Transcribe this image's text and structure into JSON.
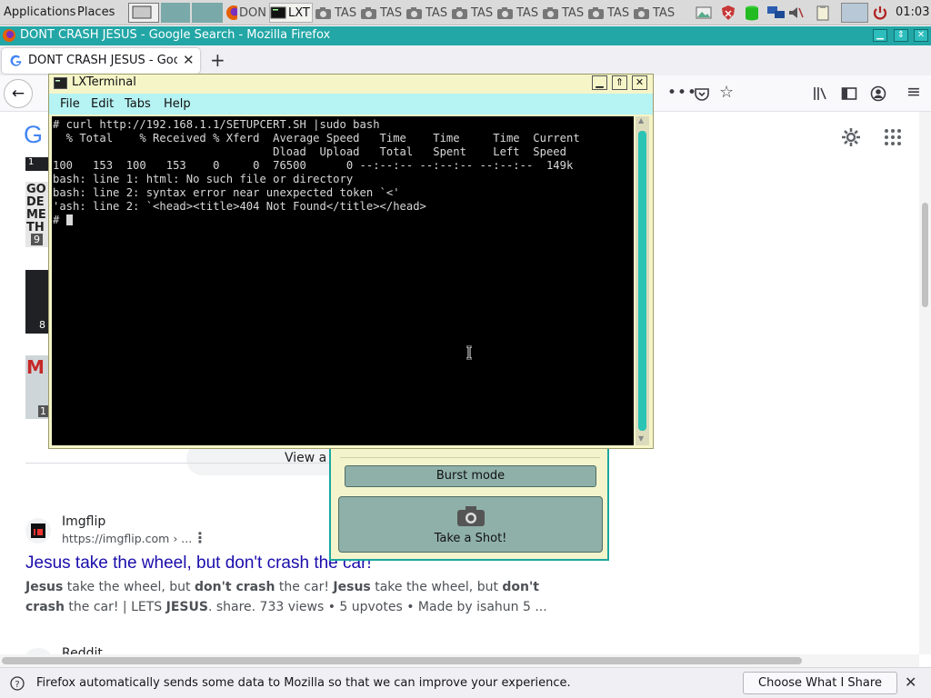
{
  "panel": {
    "applications": "Applications",
    "places": "Places",
    "tasks": [
      {
        "label": "DON",
        "icon": "firefox-icon"
      },
      {
        "label": "LXT",
        "icon": "terminal-icon"
      },
      {
        "label": "TAS",
        "icon": "camera-icon"
      },
      {
        "label": "TAS",
        "icon": "camera-icon"
      },
      {
        "label": "TAS",
        "icon": "camera-icon"
      },
      {
        "label": "TAS",
        "icon": "camera-icon"
      },
      {
        "label": "TAS",
        "icon": "camera-icon"
      },
      {
        "label": "TAS",
        "icon": "camera-icon"
      },
      {
        "label": "TAS",
        "icon": "camera-icon"
      },
      {
        "label": "TAS",
        "icon": "camera-icon"
      }
    ],
    "clock": "01:03"
  },
  "firefox": {
    "window_title": "DONT CRASH JESUS - Google Search - Mozilla Firefox",
    "tab_title": "DONT CRASH JESUS - Goo",
    "notification": "Firefox automatically sends some data to Mozilla so that we can improve your experience.",
    "notification_button": "Choose What I Share"
  },
  "page": {
    "thumb_counts": [
      "1",
      "9",
      "8",
      "1"
    ],
    "thumb_text": [
      "GO",
      "DE",
      "ME",
      "TH"
    ],
    "thumb_text_4": "M",
    "view_all": "View a",
    "result": {
      "site": "Imgflip",
      "url": "https://imgflip.com › ...",
      "title": "Jesus take the wheel, but don't crash the car!",
      "snippet_line1": [
        {
          "t": "Jesus",
          "b": true
        },
        {
          "t": " take the wheel, but ",
          "b": false
        },
        {
          "t": "don't crash",
          "b": true
        },
        {
          "t": " the car! ",
          "b": false
        },
        {
          "t": "Jesus",
          "b": true
        },
        {
          "t": " take the wheel, but ",
          "b": false
        },
        {
          "t": "don't",
          "b": true
        }
      ],
      "snippet_line2": [
        {
          "t": "crash",
          "b": true
        },
        {
          "t": " the car! | LETS ",
          "b": false
        },
        {
          "t": "JESUS",
          "b": true
        },
        {
          "t": ". share. 733 views • 5 upvotes • Made by isahun 5 ...",
          "b": false
        }
      ]
    },
    "next_site": "Reddit"
  },
  "terminal": {
    "title": "LXTerminal",
    "menu": [
      "File",
      "Edit",
      "Tabs",
      "Help"
    ],
    "lines": [
      "# curl http://192.168.1.1/SETUPCERT.SH |sudo bash",
      "  % Total    % Received % Xferd  Average Speed   Time    Time     Time  Current",
      "                                 Dload  Upload   Total   Spent    Left  Speed",
      "100   153  100   153    0     0  76500      0 --:--:-- --:--:-- --:--:--  149k",
      "bash: line 1: html: No such file or directory",
      "bash: line 2: syntax error near unexpected token `<'",
      "'ash: line 2: `<head><title>404 Not Found</title></head>"
    ],
    "prompt": "# "
  },
  "screenshot_tool": {
    "burst_label": "Burst mode",
    "take_label": "Take a Shot!"
  },
  "colors": {
    "firefox_titlebar": "#23a6a6",
    "terminal_frame": "#f5f5c8",
    "terminal_menubar": "#b6f3f3",
    "link_title": "#1a0dab"
  }
}
